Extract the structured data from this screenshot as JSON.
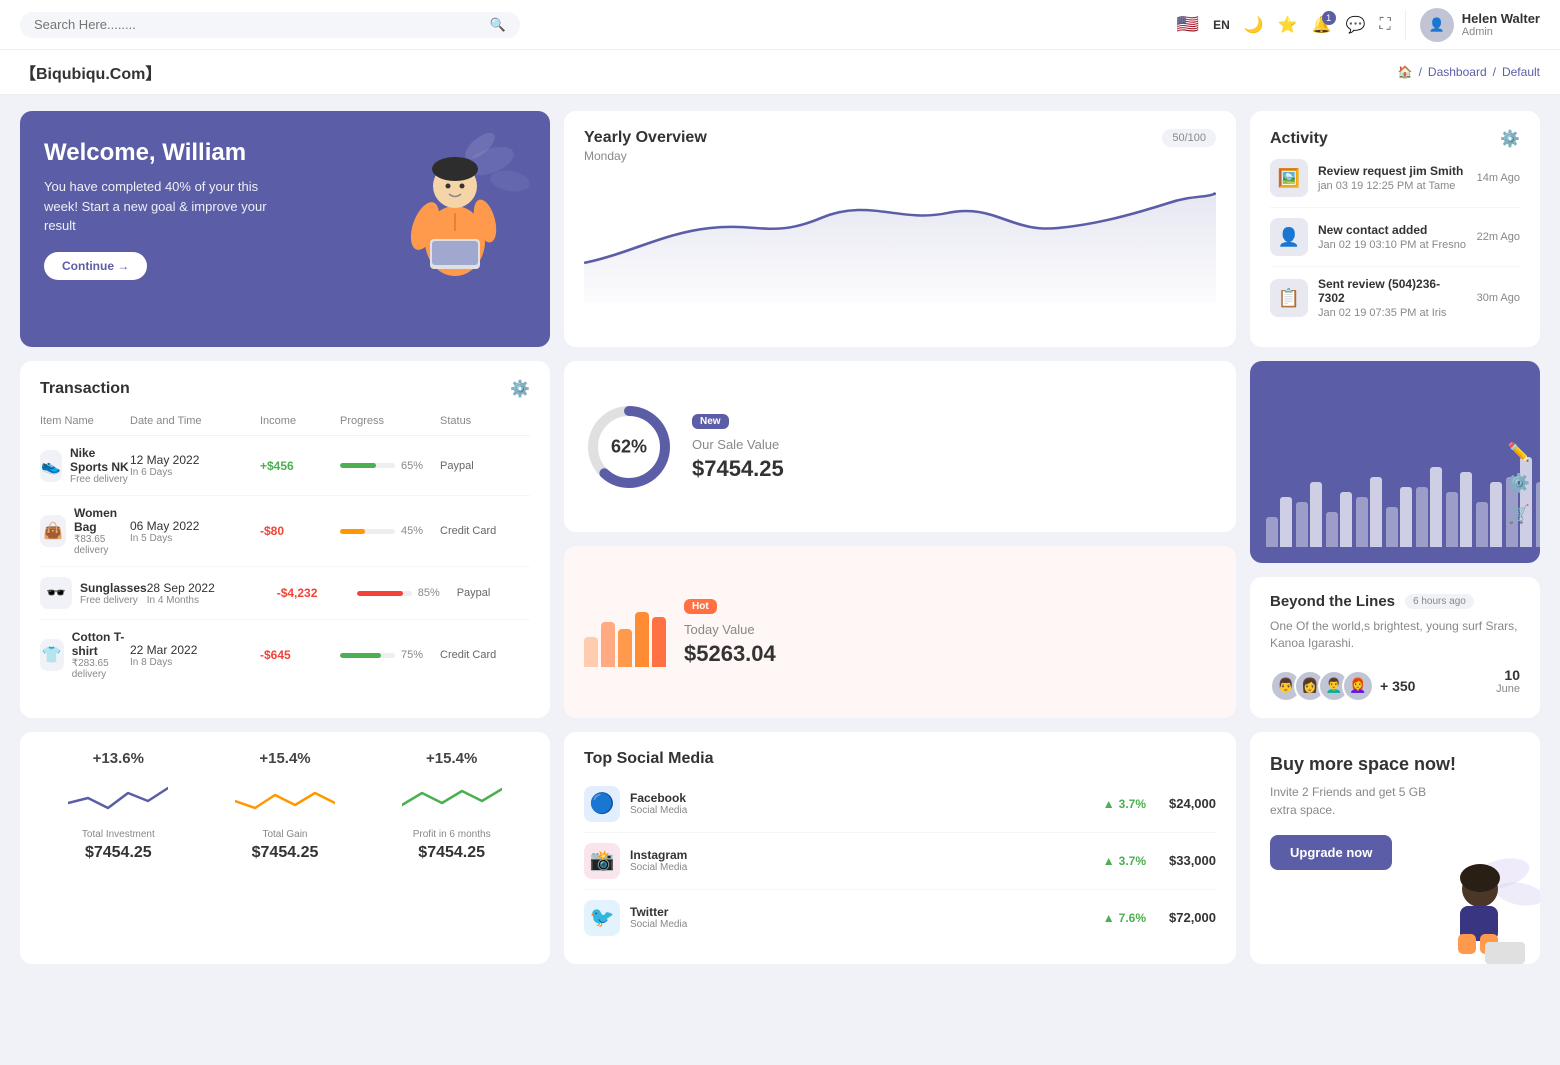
{
  "topnav": {
    "search_placeholder": "Search Here........",
    "lang": "EN",
    "notification_count": "1",
    "user_name": "Helen Walter",
    "user_role": "Admin"
  },
  "breadcrumb": {
    "brand": "【Biqubiqu.Com】",
    "home": "🏠",
    "path1": "Dashboard",
    "path2": "Default"
  },
  "welcome": {
    "title": "Welcome, William",
    "subtitle": "You have completed 40% of your this week! Start a new goal & improve your result",
    "btn": "Continue →"
  },
  "yearly": {
    "title": "Yearly Overview",
    "subtitle": "Monday",
    "badge": "50/100"
  },
  "activity": {
    "title": "Activity",
    "items": [
      {
        "title": "Review request jim Smith",
        "desc": "jan 03 19 12:25 PM at Tame",
        "time": "14m Ago",
        "emoji": "🖼️"
      },
      {
        "title": "New contact added",
        "desc": "Jan 02 19 03:10 PM at Fresno",
        "time": "22m Ago",
        "emoji": "👤"
      },
      {
        "title": "Sent review (504)236-7302",
        "desc": "Jan 02 19 07:35 PM at Iris",
        "time": "30m Ago",
        "emoji": "📋"
      }
    ]
  },
  "transaction": {
    "title": "Transaction",
    "columns": [
      "Item Name",
      "Date and Time",
      "Income",
      "Progress",
      "Status"
    ],
    "rows": [
      {
        "name": "Nike Sports NK",
        "sub": "Free delivery",
        "date": "12 May 2022",
        "days": "In 6 Days",
        "income": "+$456",
        "positive": true,
        "progress": 65,
        "progress_color": "#4caf50",
        "status": "Paypal",
        "emoji": "👟"
      },
      {
        "name": "Women Bag",
        "sub": "₹83.65 delivery",
        "date": "06 May 2022",
        "days": "In 5 Days",
        "income": "-$80",
        "positive": false,
        "progress": 45,
        "progress_color": "#ff9800",
        "status": "Credit Card",
        "emoji": "👜"
      },
      {
        "name": "Sunglasses",
        "sub": "Free delivery",
        "date": "28 Sep 2022",
        "days": "In 4 Months",
        "income": "-$4,232",
        "positive": false,
        "progress": 85,
        "progress_color": "#f44336",
        "status": "Paypal",
        "emoji": "🕶️"
      },
      {
        "name": "Cotton T-shirt",
        "sub": "₹283.65 delivery",
        "date": "22 Mar 2022",
        "days": "In 8 Days",
        "income": "-$645",
        "positive": false,
        "progress": 75,
        "progress_color": "#4caf50",
        "status": "Credit Card",
        "emoji": "👕"
      }
    ]
  },
  "sale_value": {
    "badge": "New",
    "label": "Our Sale Value",
    "value": "$7454.25",
    "percent": 62
  },
  "today_value": {
    "badge": "Hot",
    "label": "Today Value",
    "value": "$5263.04"
  },
  "chart_panel": {
    "title": "Beyond the Lines",
    "time_badge": "6 hours ago",
    "desc": "One Of the world,s brightest, young surf Srars, Kanoa Igarashi.",
    "plus_count": "+ 350",
    "date": "10",
    "month": "June"
  },
  "stats": [
    {
      "pct": "+13.6%",
      "label": "Total Investment",
      "value": "$7454.25",
      "color": "#5b5ea6"
    },
    {
      "pct": "+15.4%",
      "label": "Total Gain",
      "value": "$7454.25",
      "color": "#ff9800"
    },
    {
      "pct": "+15.4%",
      "label": "Profit in 6 months",
      "value": "$7454.25",
      "color": "#4caf50"
    }
  ],
  "social": {
    "title": "Top Social Media",
    "items": [
      {
        "name": "Facebook",
        "type": "Social Media",
        "growth": "3.7%",
        "amount": "$24,000",
        "emoji": "🔵",
        "color": "#1877f2"
      },
      {
        "name": "Instagram",
        "type": "Social Media",
        "growth": "3.7%",
        "amount": "$33,000",
        "emoji": "📸",
        "color": "#e1306c"
      },
      {
        "name": "Twitter",
        "type": "Social Media",
        "growth": "7.6%",
        "amount": "$72,000",
        "emoji": "🐦",
        "color": "#1da1f2"
      }
    ]
  },
  "upgrade": {
    "title": "Buy more space now!",
    "desc": "Invite 2 Friends and get 5 GB extra space.",
    "btn": "Upgrade now"
  }
}
